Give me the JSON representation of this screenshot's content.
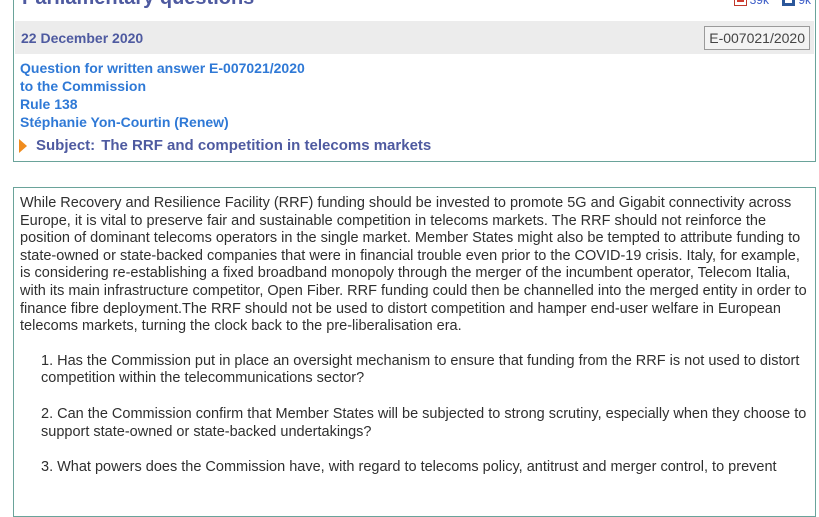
{
  "header": {
    "title": "Parliamentary questions",
    "downloads": [
      {
        "icon": "pdf-icon",
        "size": "39k"
      },
      {
        "icon": "word-icon",
        "size": "9k"
      }
    ],
    "date": "22 December 2020",
    "reference": "E-007021/2020"
  },
  "question": {
    "line1": "Question for written answer  E-007021/2020",
    "line2": "to the Commission",
    "line3": "Rule 138",
    "author": "Stéphanie Yon-Courtin (Renew)",
    "subject_label": "Subject:",
    "subject": "The RRF and competition in telecoms markets"
  },
  "body": {
    "paragraph": "While Recovery and Resilience Facility (RRF) funding should be invested to promote 5G and Gigabit connectivity across Europe, it is vital to preserve fair and sustainable competition in telecoms markets. The RRF should not reinforce the position of dominant telecoms operators in the single market. Member States might also be tempted to attribute funding to state-owned or state-backed companies that were in financial trouble even prior to the COVID-19 crisis. Italy, for example, is considering re-establishing a fixed broadband monopoly through the merger of the incumbent operator, Telecom Italia, with its main infrastructure competitor, Open Fiber. RRF funding could then be channelled into the merged entity in order to finance fibre deployment.The RRF should not be used to distort competition and hamper end-user welfare in European telecoms markets, turning the clock back to the pre-liberalisation era.",
    "questions": [
      "1. Has the Commission put in place an oversight mechanism to ensure that funding from the RRF is not used to distort competition within the telecommunications sector?",
      "2. Can the Commission confirm that Member States will be subjected to strong scrutiny, especially when they choose to support state-owned or state-backed undertakings?",
      "3. What powers does the Commission have, with regard to telecoms policy, antitrust and merger control, to prevent"
    ]
  }
}
